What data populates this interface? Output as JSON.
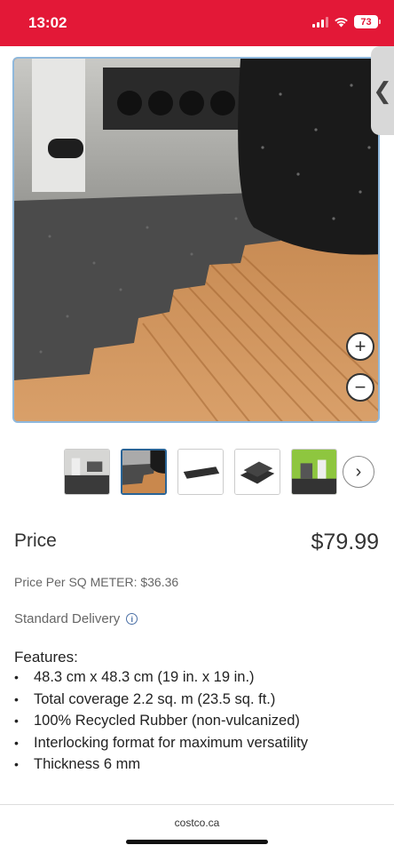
{
  "status_bar": {
    "time": "13:02",
    "battery": "73",
    "bg_color": "#e31837",
    "icons": [
      "signal-icon",
      "wifi-icon",
      "battery-icon"
    ]
  },
  "gallery": {
    "main_image": "rubber-floor-tile-roll-on-wood-floor",
    "zoom_in": "+",
    "zoom_out": "−",
    "side_tab": "❮",
    "next": "›",
    "thumbnails": [
      {
        "subject": "gym-scene-with-mats",
        "selected": false
      },
      {
        "subject": "rubber-tile-on-wood-floor",
        "selected": true
      },
      {
        "subject": "single-black-mat",
        "selected": false
      },
      {
        "subject": "stacked-black-mats",
        "selected": false
      },
      {
        "subject": "gym-room-with-green-walls",
        "selected": false
      }
    ]
  },
  "product": {
    "price_label": "Price",
    "price": "$79.99",
    "price_per_unit": "Price Per SQ METER: $36.36",
    "delivery": "Standard Delivery",
    "features_title": "Features:",
    "features": [
      "48.3 cm x 48.3 cm (19 in. x 19 in.)",
      "Total coverage 2.2 sq. m (23.5 sq. ft.)",
      "100% Recycled Rubber (non-vulcanized)",
      "Interlocking format for maximum versatility",
      "Thickness 6 mm"
    ]
  },
  "footer": {
    "domain": "costco.ca"
  }
}
